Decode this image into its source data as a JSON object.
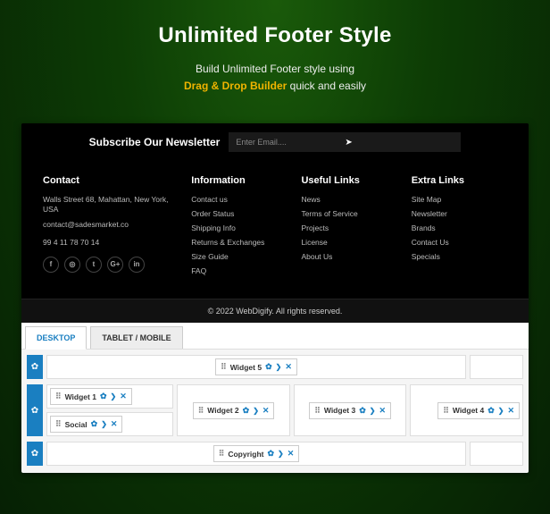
{
  "hero": {
    "title": "Unlimited Footer Style",
    "line1": "Build Unlimited Footer style using",
    "highlight": "Drag & Drop Builder",
    "line1_suffix": " quick and easily"
  },
  "newsletter": {
    "title": "Subscribe Our Newsletter",
    "placeholder": "Enter Email...."
  },
  "footer": {
    "contact": {
      "heading": "Contact",
      "address": "Walls Street 68, Mahattan, New York, USA",
      "email": "contact@sadesmarket.co",
      "phone": "99 4 11 78 70 14"
    },
    "information": {
      "heading": "Information",
      "items": [
        "Contact us",
        "Order Status",
        "Shipping Info",
        "Returns & Exchanges",
        "Size Guide",
        "FAQ"
      ]
    },
    "useful": {
      "heading": "Useful Links",
      "items": [
        "News",
        "Terms of Service",
        "Projects",
        "License",
        "About Us"
      ]
    },
    "extra": {
      "heading": "Extra Links",
      "items": [
        "Site Map",
        "Newsletter",
        "Brands",
        "Contact Us",
        "Specials"
      ]
    },
    "copyright": "© 2022 WebDigify. All rights reserved."
  },
  "builder": {
    "tabs": {
      "desktop": "DESKTOP",
      "mobile": "TABLET / MOBILE"
    },
    "widgets": {
      "w1": "Widget 1",
      "w2": "Widget 2",
      "w3": "Widget 3",
      "w4": "Widget 4",
      "w5": "Widget 5",
      "social": "Social",
      "copyright": "Copyright"
    },
    "icons": {
      "gear": "✿",
      "drag": "⠿",
      "chev": "❯",
      "x": "✕",
      "send": "➤"
    }
  }
}
